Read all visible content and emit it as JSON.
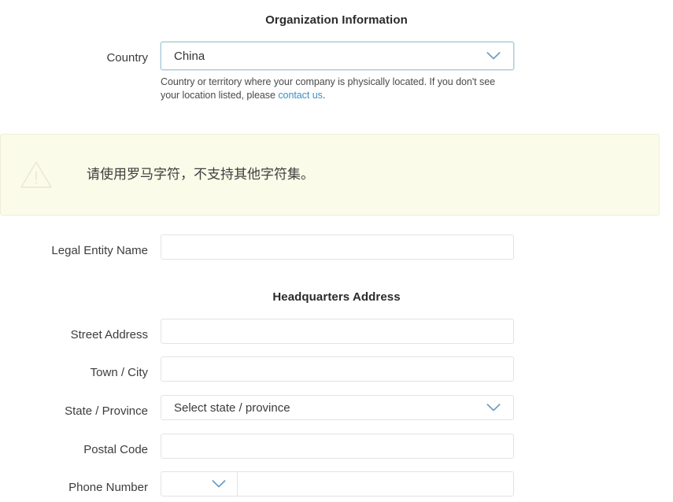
{
  "sections": {
    "organization": {
      "heading": "Organization Information"
    },
    "headquarters": {
      "heading": "Headquarters Address"
    }
  },
  "country": {
    "label": "Country",
    "value": "China",
    "chevron_icon": "chevron-down-icon",
    "helper_before": "Country or territory where your company is physically located. If you don't see your location listed, please ",
    "helper_link": "contact us",
    "helper_after": "."
  },
  "warning": {
    "icon": "warning-triangle-icon",
    "message": "请使用罗马字符，不支持其他字符集。",
    "background_color": "#fbfbe9",
    "border_color": "#efefd8"
  },
  "fields": {
    "legal_entity_name": {
      "label": "Legal Entity Name",
      "value": "",
      "placeholder": ""
    },
    "street_address": {
      "label": "Street Address",
      "value": "",
      "placeholder": ""
    },
    "town_city": {
      "label": "Town / City",
      "value": "",
      "placeholder": ""
    },
    "state_province": {
      "label": "State / Province",
      "value": "Select state / province",
      "chevron_icon": "chevron-down-icon"
    },
    "postal_code": {
      "label": "Postal Code",
      "value": "",
      "placeholder": ""
    },
    "phone_number": {
      "label": "Phone Number",
      "code_value": "",
      "code_chevron_icon": "chevron-down-icon",
      "number_value": "",
      "number_placeholder": ""
    }
  },
  "colors": {
    "link": "#3a8fc4",
    "chevron": "#6d9fc4",
    "focus_border": "#a8cdd9",
    "input_border": "#e3e3e3"
  }
}
